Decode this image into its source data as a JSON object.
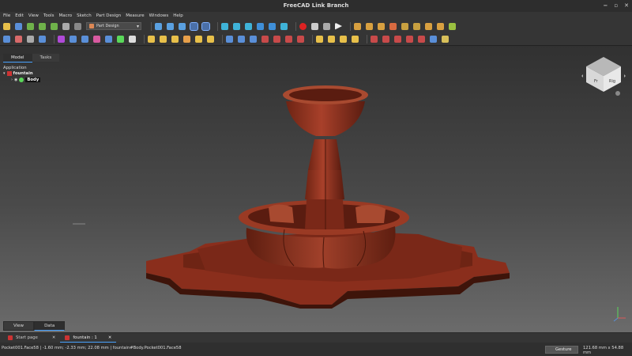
{
  "window": {
    "title": "FreeCAD Link Branch",
    "buttons": [
      "−",
      "▫",
      "✕"
    ]
  },
  "menu": [
    "File",
    "Edit",
    "View",
    "Tools",
    "Macro",
    "Sketch",
    "Part Design",
    "Measure",
    "Windows",
    "Help"
  ],
  "toolbar": {
    "workbench": "Part Design"
  },
  "tree": {
    "tabs": [
      "Model",
      "Tasks"
    ],
    "active_tab": "Model",
    "section": "Application",
    "document": "fountain",
    "body": "Body"
  },
  "bottom_tabs": [
    "View",
    "Data"
  ],
  "doc_tabs": [
    {
      "label": "Start page"
    },
    {
      "label": "fountain : 1"
    }
  ],
  "status": {
    "message": "Pocket001.Face58 | -1.60 mm; -2.33 mm; 22.08 mm | fountain#Body.Pocket001.Face58",
    "navigation_style": "Gesture",
    "dimensions": "121.68 mm x 54.88 mm"
  },
  "navcube": {
    "faces": [
      "Rig",
      "Fr"
    ]
  },
  "colors": {
    "model": "#8a2e1c",
    "model_light": "#b0452a",
    "model_dark": "#4e1a10",
    "accent": "#4aa3ff"
  }
}
